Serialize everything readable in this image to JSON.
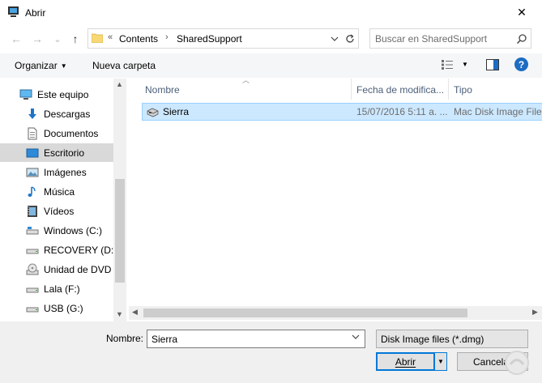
{
  "window": {
    "title": "Abrir",
    "close_glyph": "✕"
  },
  "nav": {
    "back_glyph": "←",
    "forward_glyph": "→",
    "recent_glyph": "⌄",
    "up_glyph": "↑",
    "breadcrumb_overflow": "«",
    "breadcrumbs": [
      "Contents",
      "SharedSupport"
    ],
    "breadcrumb_separator": "›",
    "search_placeholder": "Buscar en SharedSupport"
  },
  "toolbar": {
    "organize_label": "Organizar",
    "new_folder_label": "Nueva carpeta",
    "help_label": "?"
  },
  "sidebar": {
    "items": [
      {
        "label": "Este equipo",
        "icon": "computer-icon"
      },
      {
        "label": "Descargas",
        "icon": "download-icon"
      },
      {
        "label": "Documentos",
        "icon": "document-icon"
      },
      {
        "label": "Escritorio",
        "icon": "desktop-icon",
        "selected": true
      },
      {
        "label": "Imágenes",
        "icon": "image-icon"
      },
      {
        "label": "Música",
        "icon": "music-icon"
      },
      {
        "label": "Vídeos",
        "icon": "video-icon"
      },
      {
        "label": "Windows (C:)",
        "icon": "drive-icon"
      },
      {
        "label": "RECOVERY (D:)",
        "icon": "drive-icon"
      },
      {
        "label": "Unidad de DVD R",
        "icon": "dvd-icon"
      },
      {
        "label": "Lala (F:)",
        "icon": "drive-icon"
      },
      {
        "label": "USB (G:)",
        "icon": "drive-icon"
      }
    ]
  },
  "files": {
    "columns": [
      "Nombre",
      "Fecha de modifica...",
      "Tipo"
    ],
    "rows": [
      {
        "name": "Sierra",
        "date": "15/07/2016 5:11 a. ...",
        "type": "Mac Disk Image File"
      }
    ]
  },
  "bottom": {
    "name_label": "Nombre:",
    "name_value": "Sierra",
    "file_type": "Disk Image files (*.dmg)",
    "open_label": "Abrir",
    "cancel_label": "Cancelar"
  },
  "colors": {
    "selection_bg": "#cce8ff",
    "selection_border": "#99d1ff",
    "accent": "#0078d7",
    "help_blue": "#1c6cc4"
  }
}
